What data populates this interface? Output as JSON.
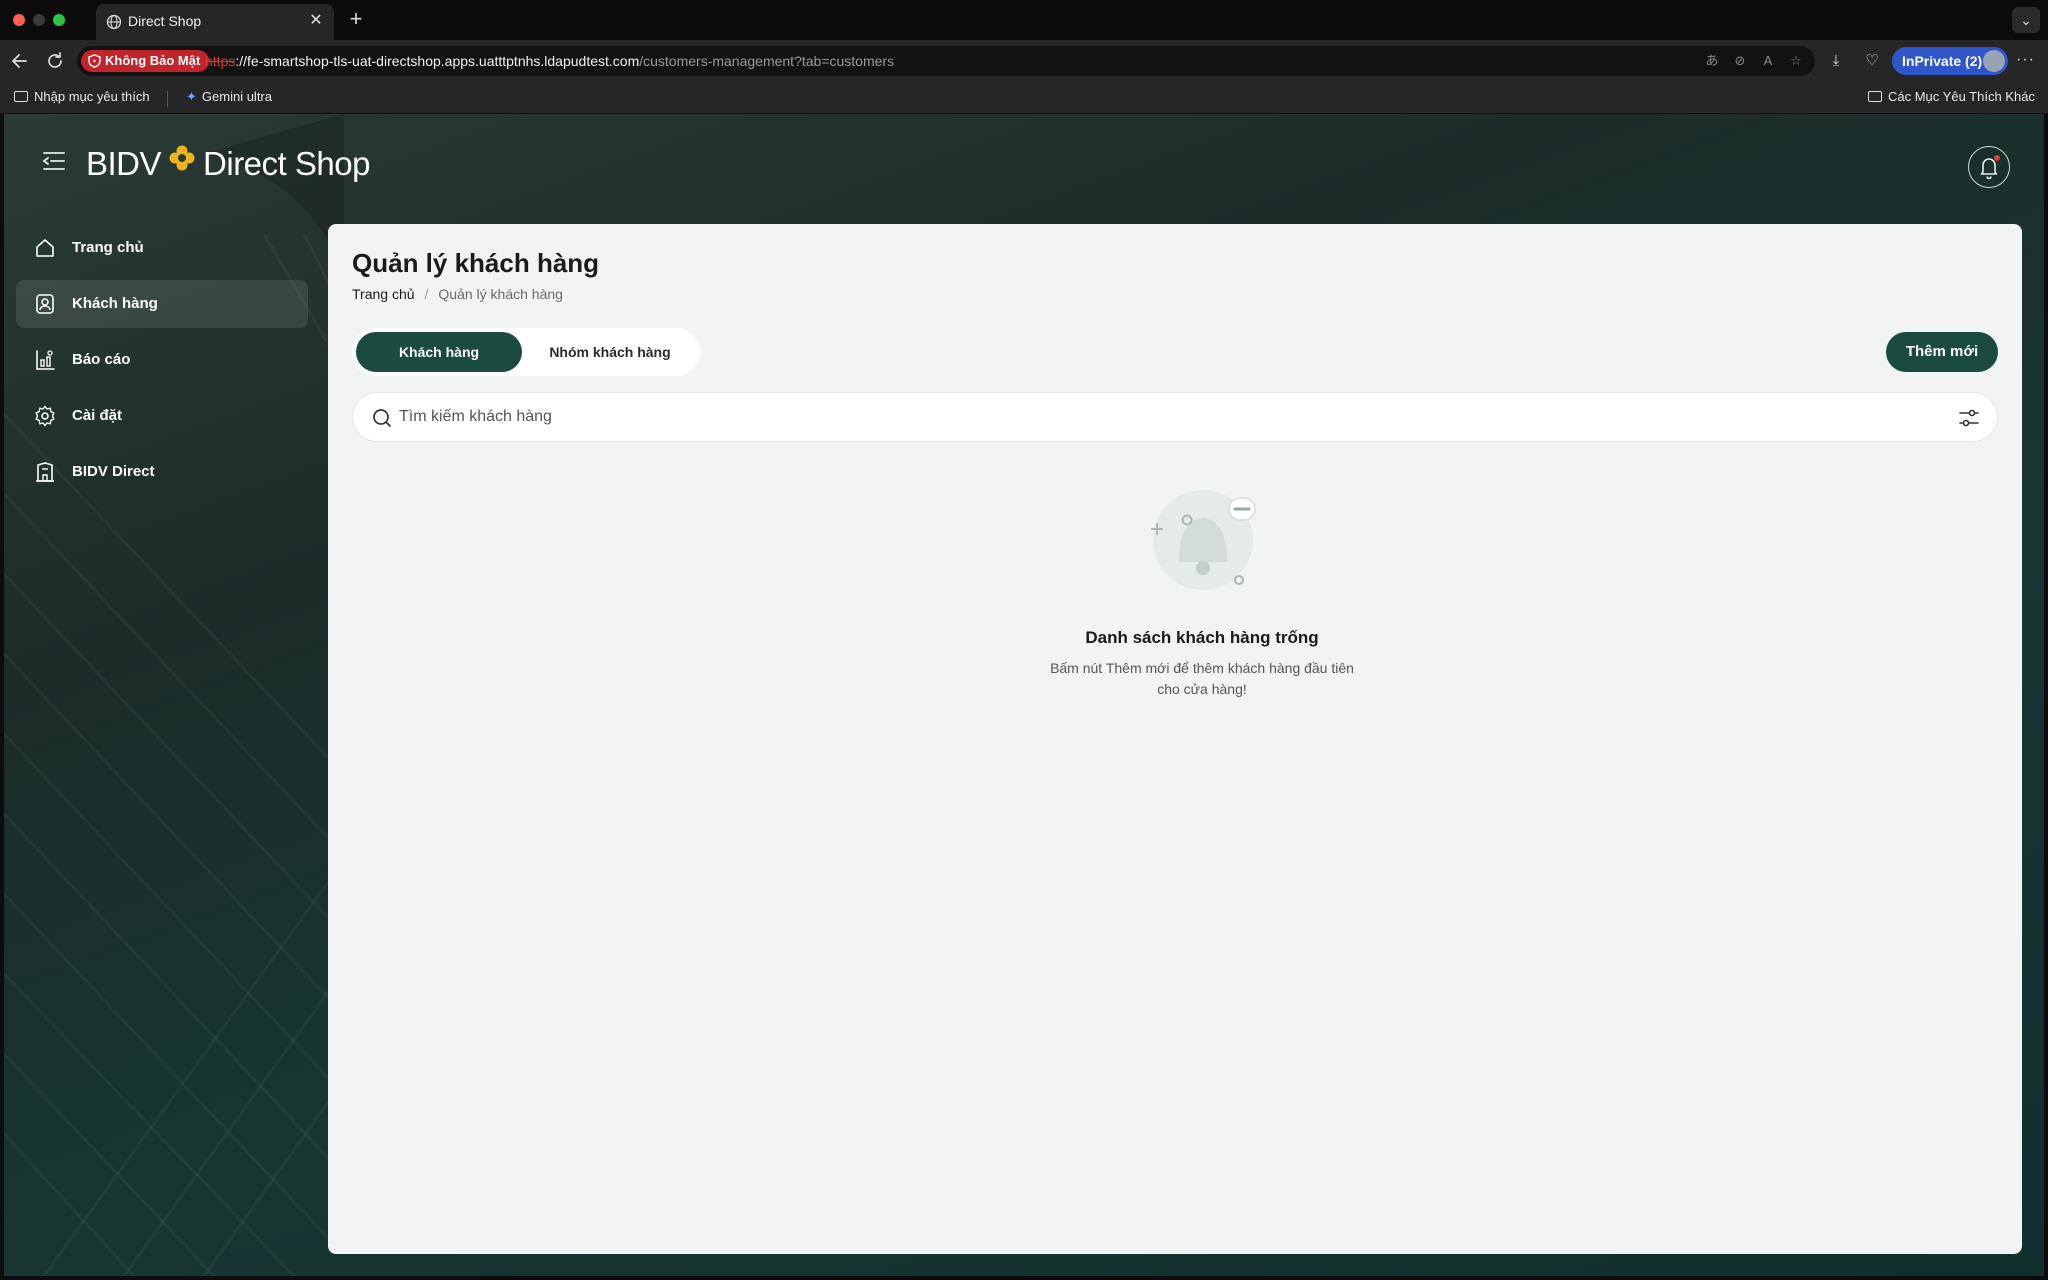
{
  "browser": {
    "tab_title": "Direct Shop",
    "security_badge": "Không Bảo Mật",
    "url_scheme": "https",
    "url_host": "://fe-smartshop-tls-uat-directshop.apps.uatttptnhs.ldapudtest.com",
    "url_path": "/customers-management?tab=customers",
    "inprivate_label": "InPrivate (2)",
    "bookmarks": {
      "import_label": "Nhập mục yêu thích",
      "gemini_label": "Gemini ultra",
      "other_label": "Các Mục Yêu Thích Khác"
    }
  },
  "app": {
    "brand_left": "BIDV",
    "brand_right": "Direct Shop"
  },
  "sidebar": {
    "items": [
      {
        "label": "Trang chủ",
        "icon": "home-icon"
      },
      {
        "label": "Khách hàng",
        "icon": "customer-icon",
        "active": true
      },
      {
        "label": "Báo cáo",
        "icon": "report-icon"
      },
      {
        "label": "Cài đặt",
        "icon": "gear-icon"
      },
      {
        "label": "BIDV Direct",
        "icon": "building-icon"
      }
    ]
  },
  "main": {
    "title": "Quản lý khách hàng",
    "breadcrumb": {
      "home": "Trang chủ",
      "separator": "/",
      "current": "Quản lý khách hàng"
    },
    "tabs": [
      {
        "label": "Khách hàng",
        "active": true
      },
      {
        "label": "Nhóm khách hàng"
      }
    ],
    "add_button": "Thêm mới",
    "search": {
      "placeholder": "Tìm kiếm khách hàng",
      "value": ""
    },
    "empty": {
      "title": "Danh sách khách hàng trống",
      "description": "Bấm nút Thêm mới để thêm khách hàng đầu tiên cho cửa hàng!"
    }
  },
  "colors": {
    "primary": "#1b4a40",
    "panel_bg": "#f2f4f3",
    "security_red": "#c2242b",
    "inprivate_blue": "#2f55c8"
  }
}
